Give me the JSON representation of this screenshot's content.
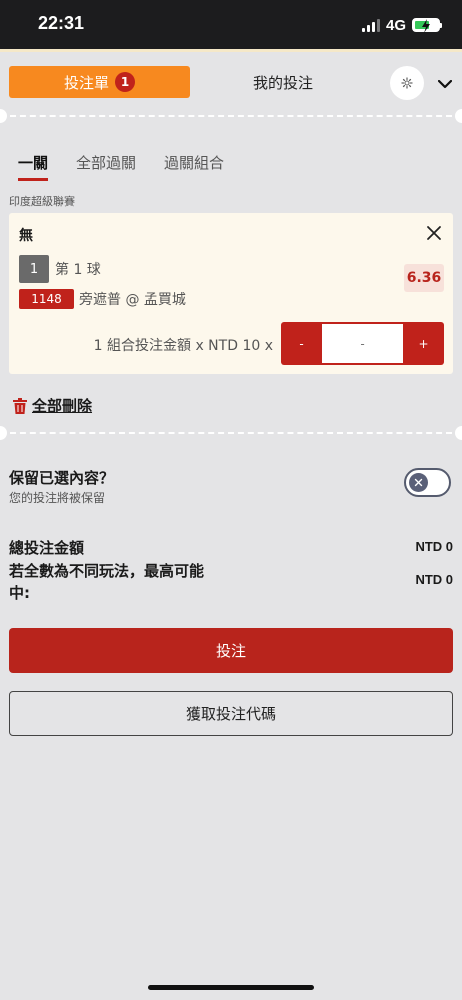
{
  "status_bar": {
    "time": "22:31",
    "network": "4G"
  },
  "header": {
    "betslip_label": "投注單",
    "betslip_count": "1",
    "mybets_label": "我的投注"
  },
  "subtabs": [
    "一關",
    "全部過關",
    "過關組合"
  ],
  "league": "印度超級聯賽",
  "bet": {
    "title": "無",
    "number": "1",
    "market": "第 1 球",
    "event_id": "1148",
    "match": "旁遮普 @ 孟買城",
    "odds": "6.36",
    "stake_label": "1 組合投注金額 x NTD 10 x",
    "minus": "-",
    "plus": "+",
    "stake_placeholder": "-"
  },
  "delete_all_label": "全部刪除",
  "keep": {
    "title": "保留已選內容？",
    "subtitle": "您的投注將被保留",
    "enabled": false
  },
  "totals": {
    "total_label": "總投注金額",
    "total_value": "NTD 0",
    "maxwin_label": "若全數為不同玩法，最高可能中:",
    "maxwin_value": "NTD 0"
  },
  "buttons": {
    "place_bet": "投注",
    "get_code": "獲取投注代碼"
  },
  "colors": {
    "accent_orange": "#f7891f",
    "brand_red": "#c0221b",
    "background": "#e4e4e6",
    "card": "#fdf8ec"
  }
}
